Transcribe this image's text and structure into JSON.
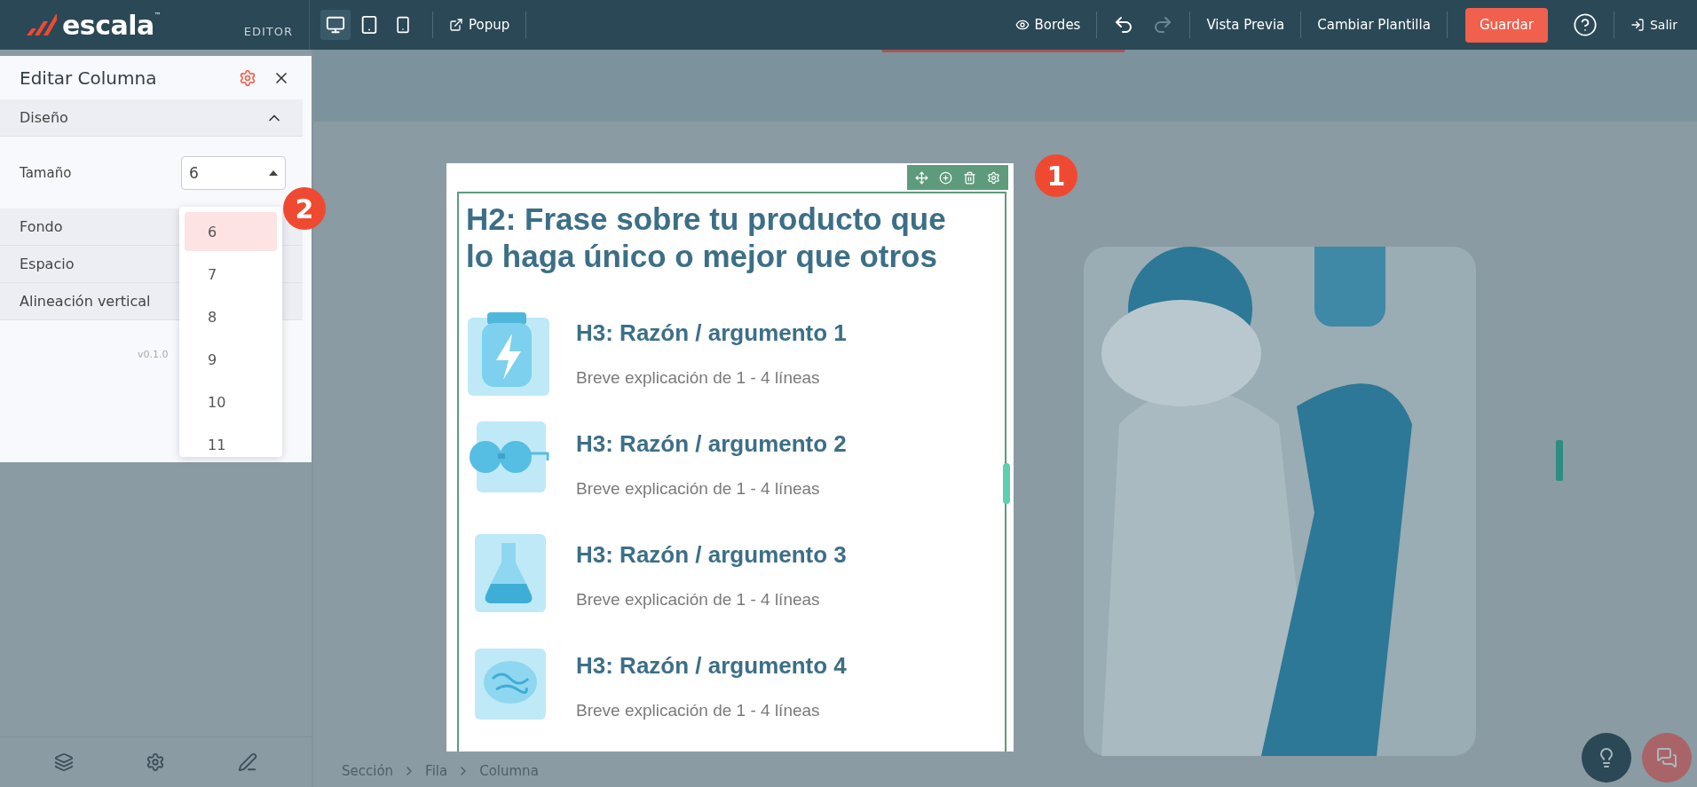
{
  "topbar": {
    "logo": "escala",
    "trademark": "™",
    "mode": "EDITOR",
    "devices": [
      {
        "kind": "desktop",
        "selected": true
      },
      {
        "kind": "tablet",
        "selected": false
      },
      {
        "kind": "phone",
        "selected": false
      }
    ],
    "popup": "Popup",
    "borders": "Bordes",
    "preview": "Vista Previa",
    "template": "Cambiar Plantilla",
    "save": "Guardar",
    "exit": "Salir"
  },
  "panel": {
    "title": "Editar Columna",
    "design_section": {
      "label": "Diseño",
      "expanded": true
    },
    "size_field": {
      "label": "Tamaño",
      "value": "6"
    },
    "sections": [
      "Fondo",
      "Espacio",
      "Alineación vertical"
    ],
    "version": "v0.1.0",
    "size_options": [
      {
        "label": "6",
        "selected": true
      },
      {
        "label": "7",
        "selected": false
      },
      {
        "label": "8",
        "selected": false
      },
      {
        "label": "9",
        "selected": false
      },
      {
        "label": "10",
        "selected": false
      },
      {
        "label": "11",
        "selected": false
      }
    ]
  },
  "canvas": {
    "heading": "H2: Frase sobre tu producto que lo haga único o mejor que otros",
    "reasons": [
      {
        "kind": "jar",
        "title": "H3: Razón / argumento 1",
        "text": "Breve explicación de 1 - 4 líneas"
      },
      {
        "kind": "goggles",
        "title": "H3: Razón / argumento 2",
        "text": "Breve explicación de 1 - 4 líneas"
      },
      {
        "kind": "flask",
        "title": "H3: Razón / argumento 3",
        "text": "Breve explicación de 1 - 4 líneas"
      },
      {
        "kind": "brain",
        "title": "H3: Razón / argumento 4",
        "text": "Breve explicación de 1 - 4 líneas"
      }
    ],
    "breadcrumb": [
      "Sección",
      "Fila",
      "Columna"
    ]
  },
  "annotations": [
    "1",
    "2"
  ]
}
